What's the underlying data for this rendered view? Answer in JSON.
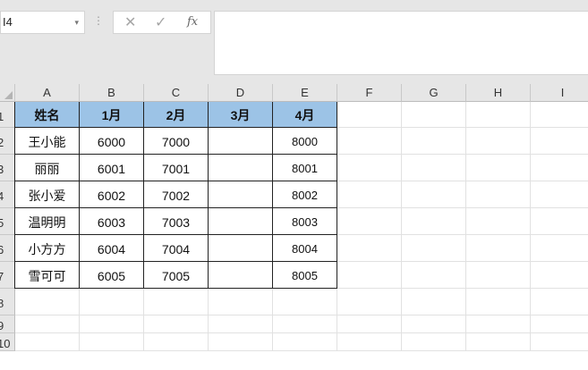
{
  "formula_bar": {
    "name_box": "I4",
    "name_box_dropdown": "▾",
    "kebab": "⋮",
    "cancel_label": "✕",
    "enter_label": "✓",
    "fx_label": "fx",
    "formula_value": ""
  },
  "columns": [
    "A",
    "B",
    "C",
    "D",
    "E",
    "F",
    "G",
    "H",
    "I"
  ],
  "rows": [
    "1",
    "2",
    "3",
    "4",
    "5",
    "6",
    "7",
    "8",
    "9",
    "10"
  ],
  "table": {
    "headers": [
      "姓名",
      "1月",
      "2月",
      "3月",
      "4月"
    ],
    "data": [
      [
        "王小能",
        "6000",
        "7000",
        "",
        "8000"
      ],
      [
        "丽丽",
        "6001",
        "7001",
        "",
        "8001"
      ],
      [
        "张小爱",
        "6002",
        "7002",
        "",
        "8002"
      ],
      [
        "温明明",
        "6003",
        "7003",
        "",
        "8003"
      ],
      [
        "小方方",
        "6004",
        "7004",
        "",
        "8004"
      ],
      [
        "雪可可",
        "6005",
        "7005",
        "",
        "8005"
      ]
    ]
  },
  "colors": {
    "header_fill": "#9cc3e6",
    "grid_line": "#e1e1e1",
    "table_border": "#222222"
  }
}
